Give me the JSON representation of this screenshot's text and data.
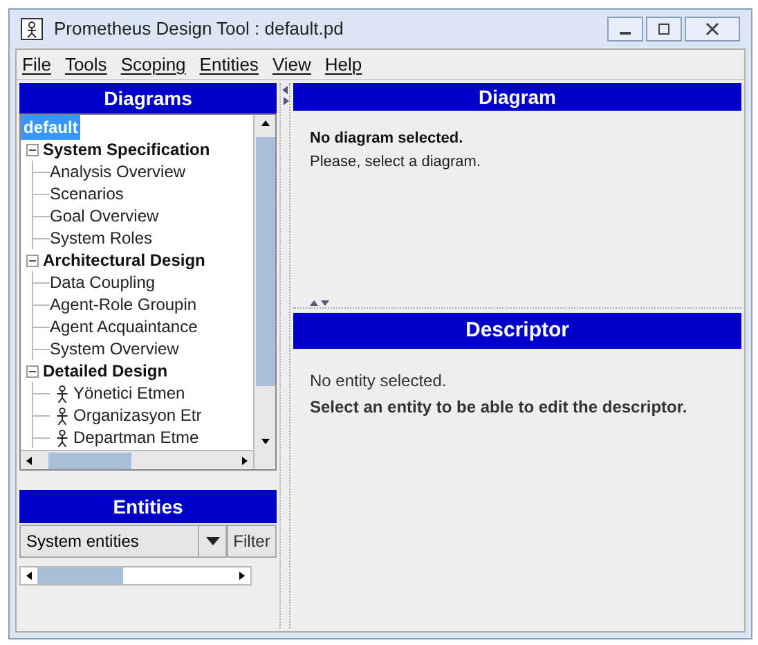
{
  "window": {
    "title": "Prometheus Design Tool : default.pd"
  },
  "menu": [
    "File",
    "Tools",
    "Scoping",
    "Entities",
    "View",
    "Help"
  ],
  "diagrams_panel": {
    "title": "Diagrams",
    "tree": {
      "label": "default",
      "selected": true,
      "children": [
        {
          "label": "System Specification",
          "expanded": true,
          "selected": false,
          "children": [
            {
              "label": "Analysis Overview",
              "kind": "diagram",
              "selected": false
            },
            {
              "label": "Scenarios",
              "kind": "diagram",
              "selected": false
            },
            {
              "label": "Goal Overview",
              "kind": "diagram",
              "selected": false
            },
            {
              "label": "System Roles",
              "kind": "diagram",
              "selected": false
            }
          ]
        },
        {
          "label": "Architectural Design",
          "expanded": true,
          "selected": false,
          "children": [
            {
              "label": "Data Coupling",
              "kind": "diagram",
              "selected": false
            },
            {
              "label": "Agent-Role Groupin",
              "kind": "diagram",
              "selected": false
            },
            {
              "label": "Agent Acquaintance",
              "kind": "diagram",
              "selected": false
            },
            {
              "label": "System Overview",
              "kind": "diagram",
              "selected": false
            }
          ]
        },
        {
          "label": "Detailed Design",
          "expanded": true,
          "selected": false,
          "children": [
            {
              "label": "Yönetici Etmen",
              "kind": "agent",
              "selected": false
            },
            {
              "label": "Organizasyon Etr",
              "kind": "agent",
              "selected": false
            },
            {
              "label": "Departman Etme",
              "kind": "agent",
              "selected": false
            }
          ]
        }
      ]
    }
  },
  "entities_panel": {
    "title": "Entities",
    "dropdown": {
      "value": "System entities"
    },
    "filter_button": "Filter"
  },
  "diagram_panel": {
    "title": "Diagram",
    "message_bold": "No diagram selected.",
    "message": "Please, select a diagram."
  },
  "descriptor_panel": {
    "title": "Descriptor",
    "lines": [
      "No entity selected.",
      "Select an entity to be able to edit the descriptor."
    ]
  }
}
